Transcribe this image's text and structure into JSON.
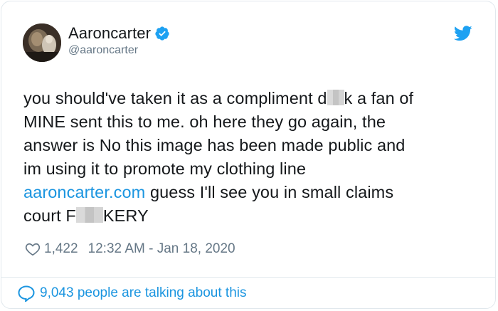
{
  "author": {
    "display_name": "Aaroncarter",
    "handle": "@aaroncarter",
    "verified": true
  },
  "tweet": {
    "line1_pre": "you should've taken it as a compliment d",
    "line1_post": "k a fan of",
    "line2": "MINE sent this to me. oh here they go again, the",
    "line3": "answer is No this image has been made public and",
    "line4": "im using it to promote my clothing line",
    "line5_link": "aaroncarter.com",
    "line5_post": " guess I'll see you in small claims",
    "line6_pre": "court F",
    "line6_post": "KERY"
  },
  "meta": {
    "likes": "1,422",
    "timestamp": "12:32 AM - Jan 18, 2020"
  },
  "footer": {
    "talking_label": "9,043 people are talking about this"
  },
  "icons": {
    "verified": "verified-badge-icon",
    "bird": "twitter-bird-icon",
    "heart": "heart-icon",
    "bubble": "speech-bubble-icon"
  },
  "colors": {
    "accent": "#1b95e0",
    "verified": "#1da1f2",
    "muted": "#657786",
    "text": "#14171a"
  }
}
